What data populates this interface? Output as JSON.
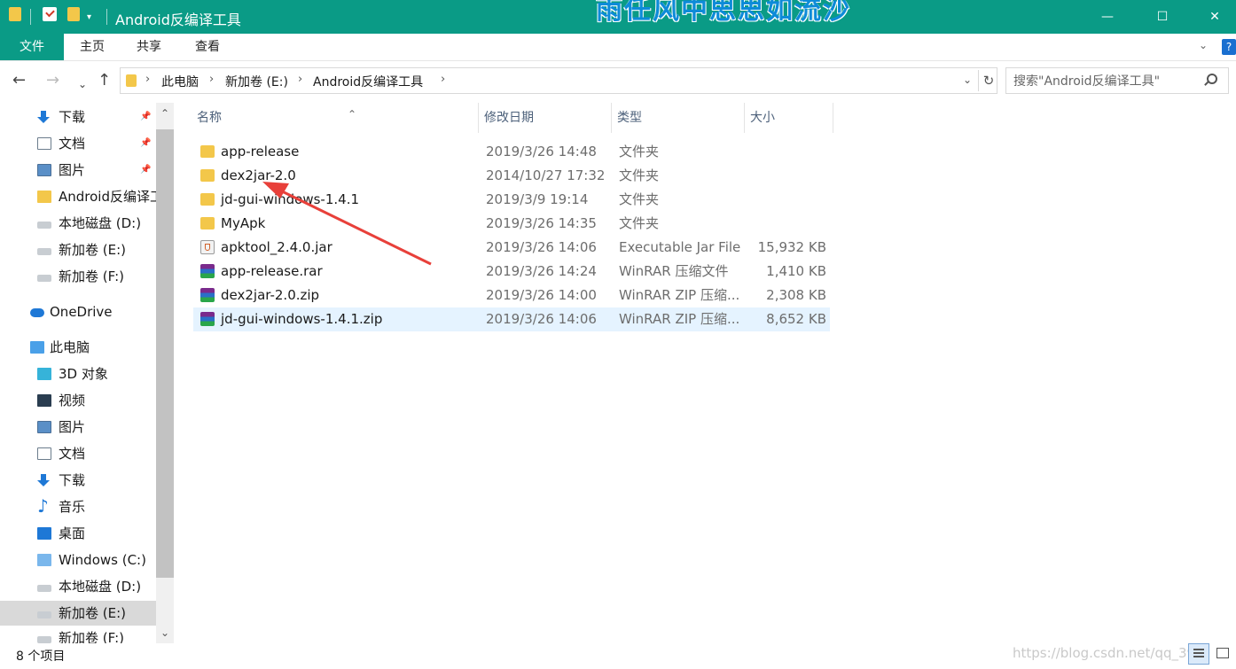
{
  "window": {
    "title": "Android反编译工具",
    "overlay_text": "雨任风中思思如流沙",
    "min_glyph": "—",
    "max_glyph": "☐",
    "close_glyph": "✕"
  },
  "ribbon": {
    "tabs": [
      "文件",
      "主页",
      "共享",
      "查看"
    ],
    "help": "?"
  },
  "address": {
    "breadcrumbs": [
      "此电脑",
      "新加卷 (E:)",
      "Android反编译工具"
    ],
    "search_placeholder": "搜索\"Android反编译工具\""
  },
  "nav_icons": {
    "back": "←",
    "forward": "→",
    "recent": "⌄",
    "up": "↑",
    "refresh": "↻"
  },
  "sidebar": {
    "items": [
      {
        "label": "下载",
        "icon": "download-icon",
        "pinned": true
      },
      {
        "label": "文档",
        "icon": "document-icon",
        "pinned": true
      },
      {
        "label": "图片",
        "icon": "picture-icon",
        "pinned": true
      },
      {
        "label": "Android反编译工",
        "icon": "folder-icon",
        "pinned": false
      },
      {
        "label": "本地磁盘 (D:)",
        "icon": "drive-icon",
        "pinned": false
      },
      {
        "label": "新加卷 (E:)",
        "icon": "drive-icon",
        "pinned": false
      },
      {
        "label": "新加卷 (F:)",
        "icon": "drive-icon",
        "pinned": false
      },
      {
        "label": "OneDrive",
        "icon": "onedrive-icon",
        "pinned": false
      },
      {
        "label": "此电脑",
        "icon": "this-pc-icon",
        "pinned": false
      },
      {
        "label": "3D 对象",
        "icon": "3d-objects-icon",
        "pinned": false
      },
      {
        "label": "视频",
        "icon": "video-icon",
        "pinned": false
      },
      {
        "label": "图片",
        "icon": "picture-icon",
        "pinned": false
      },
      {
        "label": "文档",
        "icon": "document-icon",
        "pinned": false
      },
      {
        "label": "下载",
        "icon": "download-icon",
        "pinned": false
      },
      {
        "label": "音乐",
        "icon": "music-icon",
        "pinned": false
      },
      {
        "label": "桌面",
        "icon": "desktop-icon",
        "pinned": false
      },
      {
        "label": "Windows (C:)",
        "icon": "windows-drive-icon",
        "pinned": false
      },
      {
        "label": "本地磁盘 (D:)",
        "icon": "drive-icon",
        "pinned": false
      },
      {
        "label": "新加卷 (E:)",
        "icon": "drive-icon",
        "pinned": false,
        "selected": true
      },
      {
        "label": "新加卷 (F:)",
        "icon": "drive-icon",
        "pinned": false
      }
    ]
  },
  "columns": [
    "名称",
    "修改日期",
    "类型",
    "大小"
  ],
  "files": [
    {
      "name": "app-release",
      "date": "2019/3/26 14:48",
      "type": "文件夹",
      "size": "",
      "icon": "folder-icon"
    },
    {
      "name": "dex2jar-2.0",
      "date": "2014/10/27 17:32",
      "type": "文件夹",
      "size": "",
      "icon": "folder-icon"
    },
    {
      "name": "jd-gui-windows-1.4.1",
      "date": "2019/3/9 19:14",
      "type": "文件夹",
      "size": "",
      "icon": "folder-icon"
    },
    {
      "name": "MyApk",
      "date": "2019/3/26 14:35",
      "type": "文件夹",
      "size": "",
      "icon": "folder-icon"
    },
    {
      "name": "apktool_2.4.0.jar",
      "date": "2019/3/26 14:06",
      "type": "Executable Jar File",
      "size": "15,932 KB",
      "icon": "jar-file-icon"
    },
    {
      "name": "app-release.rar",
      "date": "2019/3/26 14:24",
      "type": "WinRAR 压缩文件",
      "size": "1,410 KB",
      "icon": "winrar-file-icon"
    },
    {
      "name": "dex2jar-2.0.zip",
      "date": "2019/3/26 14:00",
      "type": "WinRAR ZIP 压缩...",
      "size": "2,308 KB",
      "icon": "winrar-file-icon"
    },
    {
      "name": "jd-gui-windows-1.4.1.zip",
      "date": "2019/3/26 14:06",
      "type": "WinRAR ZIP 压缩...",
      "size": "8,652 KB",
      "icon": "winrar-file-icon",
      "selected": true
    }
  ],
  "status": {
    "item_count": "8 个项目",
    "watermark": "https://blog.csdn.net/qq_399"
  },
  "colors": {
    "titlebar": "#0a9b86",
    "selection": "#e5f3ff",
    "annotation_arrow": "#e8403a"
  }
}
